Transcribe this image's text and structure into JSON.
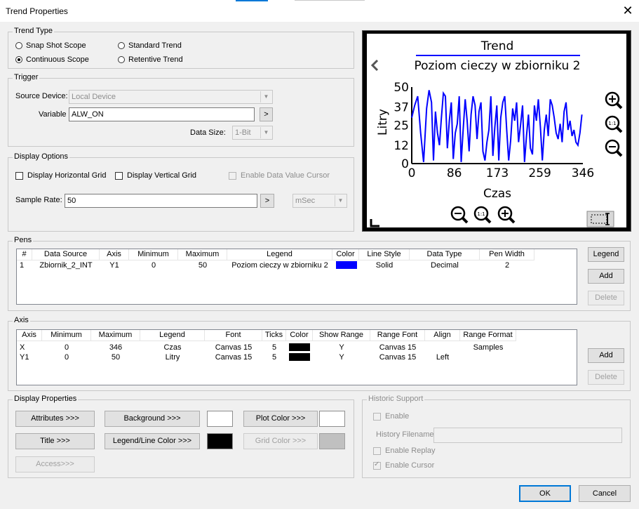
{
  "window": {
    "title": "Trend Properties",
    "close_glyph": "✕"
  },
  "trend_type": {
    "label": "Trend Type",
    "options": [
      "Snap Shot Scope",
      "Standard Trend",
      "Continuous Scope",
      "Retentive Trend"
    ],
    "selected": "Continuous Scope"
  },
  "trigger": {
    "label": "Trigger",
    "source_device_label": "Source Device:",
    "source_device_value": "Local Device",
    "variable_label": "Variable",
    "variable_value": "ALW_ON",
    "browse_label": ">",
    "data_size_label": "Data Size:",
    "data_size_value": "1-Bit"
  },
  "display_options": {
    "label": "Display Options",
    "horizontal_grid": "Display Horizontal Grid",
    "vertical_grid": "Display Vertical Grid",
    "data_value_cursor": "Enable Data Value Cursor",
    "sample_rate_label": "Sample Rate:",
    "sample_rate_value": "50",
    "browse_label": ">",
    "unit_value": "mSec"
  },
  "preview": {
    "title": "Trend",
    "subtitle": "Poziom cieczy w zbiorniku 2",
    "ylabel": "Litry",
    "xlabel": "Czas",
    "zoom_reset_text": "1:1",
    "icons": [
      "back-arrow-icon",
      "zoom-in-icon",
      "zoom-reset-icon",
      "zoom-out-icon",
      "corner-icon",
      "select-area-icon"
    ]
  },
  "chart_data": {
    "type": "line",
    "title": "Trend",
    "subtitle": "Poziom cieczy w zbiorniku 2",
    "xlabel": "Czas",
    "ylabel": "Litry",
    "x_ticks": [
      "0",
      "86",
      "173",
      "259",
      "346"
    ],
    "y_ticks": [
      "50",
      "37",
      "25",
      "12",
      "0"
    ],
    "xlim": [
      0,
      346
    ],
    "ylim": [
      0,
      50
    ],
    "grid": false,
    "series": [
      {
        "color": "#0000ff",
        "points": [
          [
            0,
            30
          ],
          [
            6,
            38
          ],
          [
            12,
            44
          ],
          [
            18,
            20
          ],
          [
            24,
            1
          ],
          [
            30,
            36
          ],
          [
            35,
            48
          ],
          [
            40,
            40
          ],
          [
            44,
            2
          ],
          [
            48,
            34
          ],
          [
            52,
            20
          ],
          [
            56,
            12
          ],
          [
            60,
            30
          ],
          [
            64,
            46
          ],
          [
            68,
            44
          ],
          [
            72,
            10
          ],
          [
            76,
            28
          ],
          [
            80,
            40
          ],
          [
            84,
            3
          ],
          [
            88,
            20
          ],
          [
            92,
            26
          ],
          [
            96,
            44
          ],
          [
            100,
            1
          ],
          [
            104,
            22
          ],
          [
            108,
            42
          ],
          [
            112,
            28
          ],
          [
            116,
            8
          ],
          [
            120,
            32
          ],
          [
            124,
            44
          ],
          [
            128,
            38
          ],
          [
            132,
            16
          ],
          [
            136,
            34
          ],
          [
            140,
            40
          ],
          [
            144,
            8
          ],
          [
            148,
            2
          ],
          [
            152,
            14
          ],
          [
            156,
            22
          ],
          [
            160,
            44
          ],
          [
            164,
            5
          ],
          [
            168,
            24
          ],
          [
            172,
            38
          ],
          [
            176,
            2
          ],
          [
            180,
            30
          ],
          [
            184,
            40
          ],
          [
            188,
            44
          ],
          [
            192,
            22
          ],
          [
            196,
            2
          ],
          [
            200,
            15
          ],
          [
            204,
            36
          ],
          [
            208,
            28
          ],
          [
            212,
            40
          ],
          [
            216,
            14
          ],
          [
            220,
            25
          ],
          [
            224,
            38
          ],
          [
            228,
            1
          ],
          [
            232,
            18
          ],
          [
            236,
            32
          ],
          [
            240,
            10
          ],
          [
            244,
            6
          ],
          [
            248,
            38
          ],
          [
            252,
            28
          ],
          [
            256,
            42
          ],
          [
            260,
            24
          ],
          [
            264,
            2
          ],
          [
            268,
            22
          ],
          [
            272,
            32
          ],
          [
            276,
            18
          ],
          [
            280,
            42
          ],
          [
            284,
            38
          ],
          [
            288,
            30
          ],
          [
            292,
            20
          ],
          [
            296,
            16
          ],
          [
            300,
            26
          ],
          [
            304,
            14
          ],
          [
            308,
            34
          ],
          [
            312,
            40
          ],
          [
            316,
            22
          ],
          [
            320,
            28
          ],
          [
            324,
            18
          ],
          [
            328,
            22
          ],
          [
            332,
            14
          ],
          [
            336,
            12
          ],
          [
            340,
            20
          ],
          [
            344,
            32
          ]
        ]
      }
    ]
  },
  "pens": {
    "label": "Pens",
    "columns": [
      "#",
      "Data Source",
      "Axis",
      "Minimum",
      "Maximum",
      "Legend",
      "Color",
      "Line Style",
      "Data Type",
      "Pen Width"
    ],
    "rows": [
      {
        "num": "1",
        "source": "Zbiornik_2_INT",
        "axis": "Y1",
        "min": "0",
        "max": "50",
        "legend": "Poziom cieczy w zbiorniku 2",
        "color": "#0000ff",
        "style": "Solid",
        "type": "Decimal",
        "width": "2"
      }
    ],
    "buttons": {
      "legend": "Legend",
      "add": "Add",
      "delete": "Delete"
    }
  },
  "axis": {
    "label": "Axis",
    "columns": [
      "Axis",
      "Minimum",
      "Maximum",
      "Legend",
      "Font",
      "Ticks",
      "Color",
      "Show Range",
      "Range Font",
      "Align",
      "Range Format"
    ],
    "rows": [
      {
        "axis": "X",
        "min": "0",
        "max": "346",
        "legend": "Czas",
        "font": "Canvas 15",
        "ticks": "5",
        "color": "#000000",
        "show_range": "Y",
        "range_font": "Canvas 15",
        "align": "",
        "format": "Samples"
      },
      {
        "axis": "Y1",
        "min": "0",
        "max": "50",
        "legend": "Litry",
        "font": "Canvas 15",
        "ticks": "5",
        "color": "#000000",
        "show_range": "Y",
        "range_font": "Canvas 15",
        "align": "Left",
        "format": ""
      }
    ],
    "buttons": {
      "add": "Add",
      "delete": "Delete"
    }
  },
  "display_properties": {
    "label": "Display Properties",
    "attributes": "Attributes >>>",
    "background": "Background >>>",
    "plot_color": "Plot Color >>>",
    "title": "Title >>>",
    "legend_line_color": "Legend/Line Color >>>",
    "grid_color": "Grid Color >>>",
    "access": "Access>>>",
    "background_color": "#ffffff",
    "plot_color_value": "#ffffff",
    "legend_color_value": "#000000",
    "grid_color_value": "#c0c0c0"
  },
  "historic_support": {
    "label": "Historic Support",
    "enable": "Enable",
    "history_filename_label": "History Filename",
    "history_filename_value": "",
    "enable_replay": "Enable Replay",
    "enable_cursor": "Enable Cursor"
  },
  "footer": {
    "ok": "OK",
    "cancel": "Cancel"
  }
}
